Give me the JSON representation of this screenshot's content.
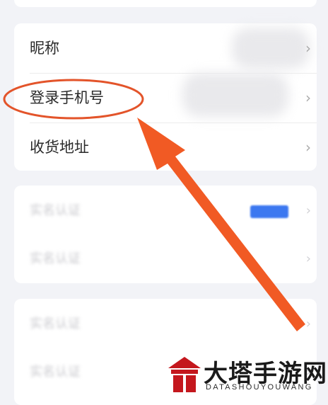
{
  "settings": {
    "rows": [
      {
        "label": "昵称"
      },
      {
        "label": "登录手机号"
      },
      {
        "label": "收货地址"
      }
    ],
    "chevron": "›"
  },
  "blurred_section_1": {
    "rows": [
      "实名认证",
      "实名认证"
    ]
  },
  "blurred_section_2": {
    "rows": [
      "实名认证",
      "实名认证"
    ]
  },
  "annotation": {
    "arrow_color": "#f15a24",
    "circle_color": "#e3542a"
  },
  "watermark": {
    "title": "大塔手游网",
    "subtitle": "DATASHOUYOUWANG",
    "brand_color": "#c4171d"
  }
}
